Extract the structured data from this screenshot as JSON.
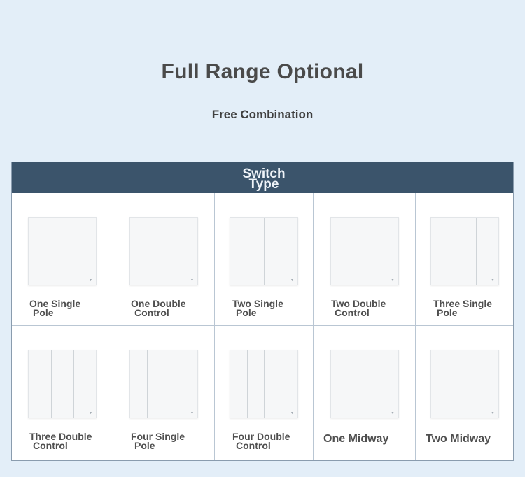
{
  "title": "Full Range Optional",
  "subtitle": "Free Combination",
  "header": {
    "label": "Switch Type"
  },
  "items": [
    {
      "line1": "One Single",
      "line2": "Pole",
      "gangs": 1
    },
    {
      "line1": "One Double",
      "line2": "Control",
      "gangs": 1
    },
    {
      "line1": "Two Single",
      "line2": "Pole",
      "gangs": 2
    },
    {
      "line1": "Two Double",
      "line2": "Control",
      "gangs": 2
    },
    {
      "line1": "Three Single",
      "line2": "Pole",
      "gangs": 3
    },
    {
      "line1": "Three Double",
      "line2": "Control",
      "gangs": 3
    },
    {
      "line1": "Four Single",
      "line2": "Pole",
      "gangs": 4
    },
    {
      "line1": "Four Double",
      "line2": "Control",
      "gangs": 4
    },
    {
      "line1": "One Midway",
      "line2": "",
      "gangs": 1
    },
    {
      "line1": "Two Midway",
      "line2": "",
      "gangs": 2
    }
  ]
}
